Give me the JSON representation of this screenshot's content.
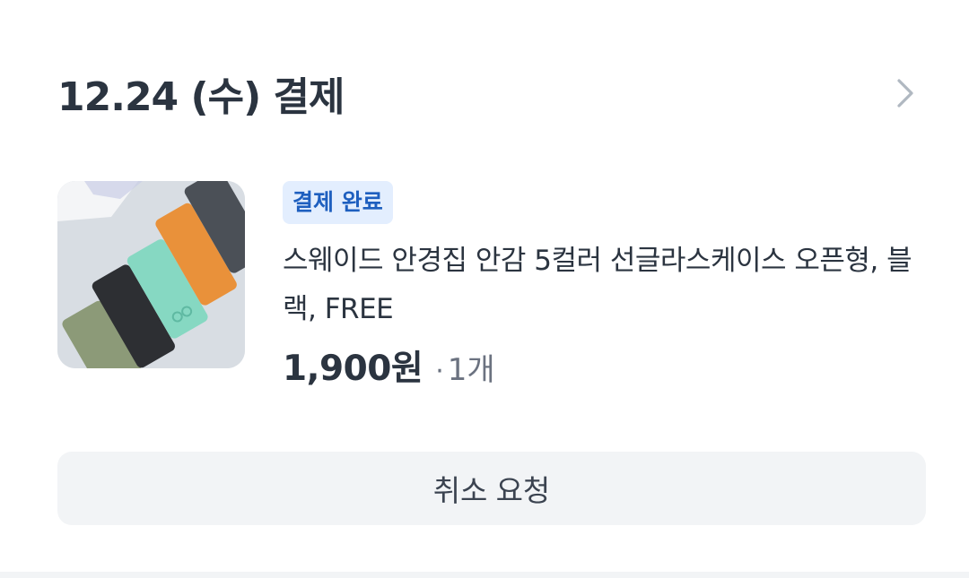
{
  "header": {
    "title": "12.24 (수) 결제",
    "chevron_icon": "chevron-right-icon"
  },
  "order": {
    "status_badge": "결제 완료",
    "product_name": "스웨이드 안경집 안감 5컬러 선글라스케이스 오픈형, 블랙, FREE",
    "price": "1,900원",
    "separator": "·",
    "quantity": "1개",
    "thumbnail_icon": "product-image"
  },
  "actions": {
    "cancel_label": "취소 요청"
  },
  "colors": {
    "badge_bg": "#e3eefe",
    "badge_text": "#1e5fbf",
    "button_bg": "#f2f4f6",
    "title_text": "#2b3440",
    "muted_text": "#6b7280"
  }
}
